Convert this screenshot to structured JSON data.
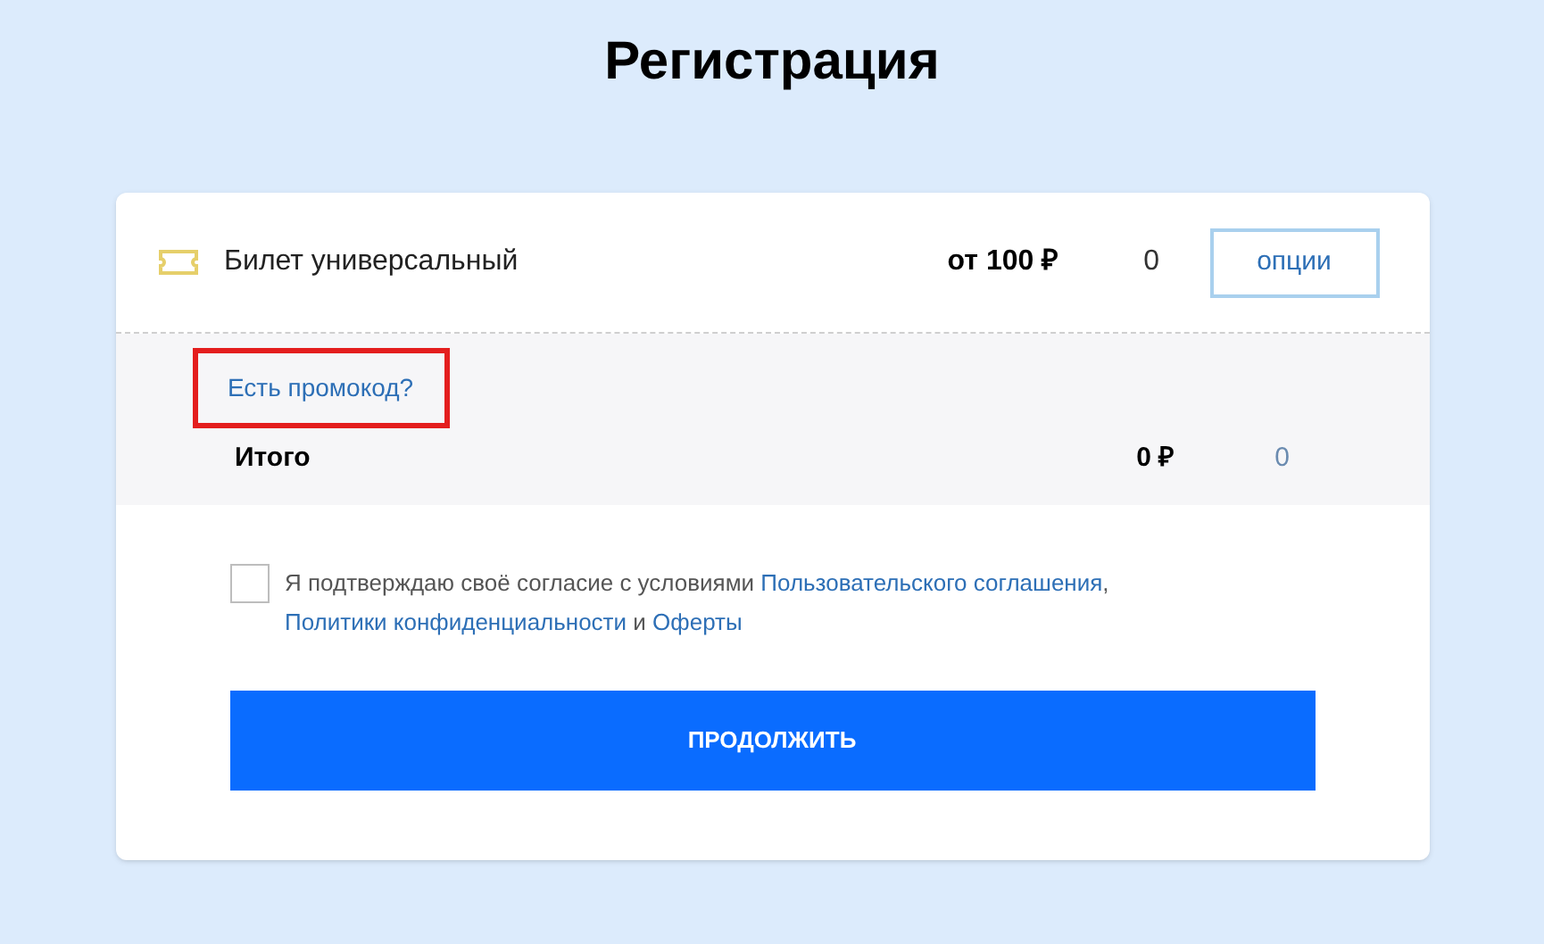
{
  "title": "Регистрация",
  "ticket": {
    "name": "Билет универсальный",
    "price": "от 100 ₽",
    "quantity": "0",
    "options_button": "опции"
  },
  "promo": {
    "link": "Есть промокод?",
    "highlighted": true
  },
  "total": {
    "label": "Итого",
    "amount": "0 ₽",
    "quantity": "0"
  },
  "consent": {
    "checked": false,
    "parts": [
      {
        "kind": "text",
        "text": "Я подтверждаю своё согласие с условиями "
      },
      {
        "kind": "link",
        "text": "Пользовательского соглашения"
      },
      {
        "kind": "text",
        "text": ", "
      },
      {
        "kind": "link",
        "text": "Политики конфиденциальности"
      },
      {
        "kind": "text",
        "text": " и "
      },
      {
        "kind": "link",
        "text": "Оферты"
      }
    ]
  },
  "submit_button": "ПРОДОЛЖИТЬ"
}
